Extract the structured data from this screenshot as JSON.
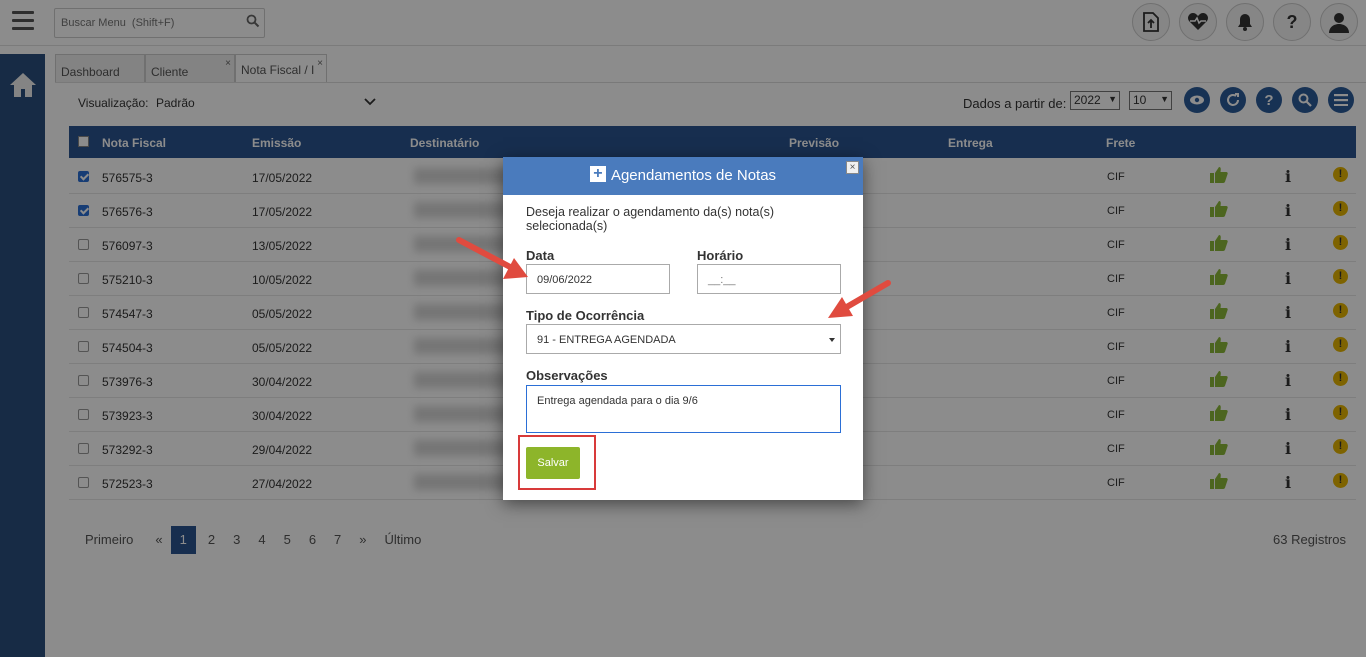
{
  "search": {
    "placeholder": "Buscar Menu  (Shift+F)"
  },
  "tabs": [
    {
      "label": "Dashboard"
    },
    {
      "label": "Cliente"
    },
    {
      "label": "Nota Fiscal / I"
    }
  ],
  "tab_close": "×",
  "view": {
    "label": "Visualização:",
    "value": "Padrão"
  },
  "dados": {
    "label": "Dados a partir de:",
    "year": "2022",
    "count": "10"
  },
  "table": {
    "headers": {
      "nota": "Nota Fiscal",
      "emissao": "Emissão",
      "destinatario": "Destinatário",
      "previsao": "Previsão",
      "entrega": "Entrega",
      "frete": "Frete"
    },
    "rows": [
      {
        "nf": "576575-3",
        "emissao": "17/05/2022",
        "frete": "CIF",
        "checked": true
      },
      {
        "nf": "576576-3",
        "emissao": "17/05/2022",
        "frete": "CIF",
        "checked": true
      },
      {
        "nf": "576097-3",
        "emissao": "13/05/2022",
        "frete": "CIF",
        "checked": false
      },
      {
        "nf": "575210-3",
        "emissao": "10/05/2022",
        "frete": "CIF",
        "checked": false
      },
      {
        "nf": "574547-3",
        "emissao": "05/05/2022",
        "frete": "CIF",
        "checked": false
      },
      {
        "nf": "574504-3",
        "emissao": "05/05/2022",
        "frete": "CIF",
        "checked": false
      },
      {
        "nf": "573976-3",
        "emissao": "30/04/2022",
        "frete": "CIF",
        "checked": false
      },
      {
        "nf": "573923-3",
        "emissao": "30/04/2022",
        "frete": "CIF",
        "checked": false
      },
      {
        "nf": "573292-3",
        "emissao": "29/04/2022",
        "frete": "CIF",
        "checked": false
      },
      {
        "nf": "572523-3",
        "emissao": "27/04/2022",
        "frete": "CIF",
        "checked": false
      }
    ]
  },
  "pager": {
    "first": "Primeiro",
    "prev": "«",
    "pages": [
      "1",
      "2",
      "3",
      "4",
      "5",
      "6",
      "7"
    ],
    "next": "»",
    "last": "Último",
    "records": "63 Registros",
    "active_page": "1"
  },
  "modal": {
    "title": "Agendamentos de Notas",
    "close": "×",
    "question": "Deseja realizar o agendamento da(s) nota(s) selecionada(s)",
    "data_label": "Data",
    "data_value": "09/06/2022",
    "horario_label": "Horário",
    "horario_value": "__:__",
    "tipo_label": "Tipo de Ocorrência",
    "tipo_value": "91 - ENTREGA AGENDADA",
    "obs_label": "Observações",
    "obs_value": "Entrega agendada para o dia 9/6",
    "save_label": "Salvar"
  },
  "colors": {
    "header": "#2b5591",
    "sidebar": "#2a4f7e",
    "modal_header": "#4a7bbd",
    "save": "#8db52a",
    "annotation": "#e04b3f"
  }
}
